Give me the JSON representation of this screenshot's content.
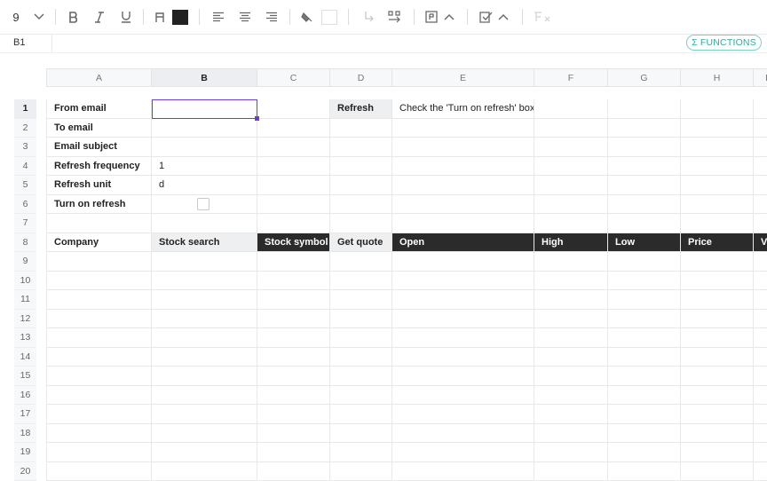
{
  "toolbar": {
    "font_size": "9",
    "text_color": "#222222"
  },
  "formula_bar": {
    "cell_ref": "B1",
    "functions_label": "Σ FUNCTIONS"
  },
  "columns": [
    "A",
    "B",
    "C",
    "D",
    "E",
    "F",
    "G",
    "H",
    "I"
  ],
  "selected_column": "B",
  "rows": [
    "1",
    "2",
    "3",
    "4",
    "5",
    "6",
    "7",
    "8",
    "9",
    "10",
    "11",
    "12",
    "13",
    "14",
    "15",
    "16",
    "17",
    "18",
    "19",
    "20"
  ],
  "selected_row": "1",
  "cells": {
    "A1": "From email",
    "A2": "To email",
    "A3": "Email subject",
    "A4": "Refresh frequency",
    "A5": "Refresh unit",
    "A6": "Turn on refresh",
    "B4": "1",
    "B5": "d",
    "D1": "Refresh",
    "E1": "Check the 'Turn on refresh' box",
    "A8": "Company",
    "B8": "Stock search",
    "C8": "Stock symbol",
    "D8": "Get quote",
    "E8": "Open",
    "F8": "High",
    "G8": "Low",
    "H8": "Price",
    "I8": "V"
  },
  "colors": {
    "selection": "#6f3cd6",
    "functions_accent": "#33a99a",
    "dark_header": "#2b2b2b"
  }
}
